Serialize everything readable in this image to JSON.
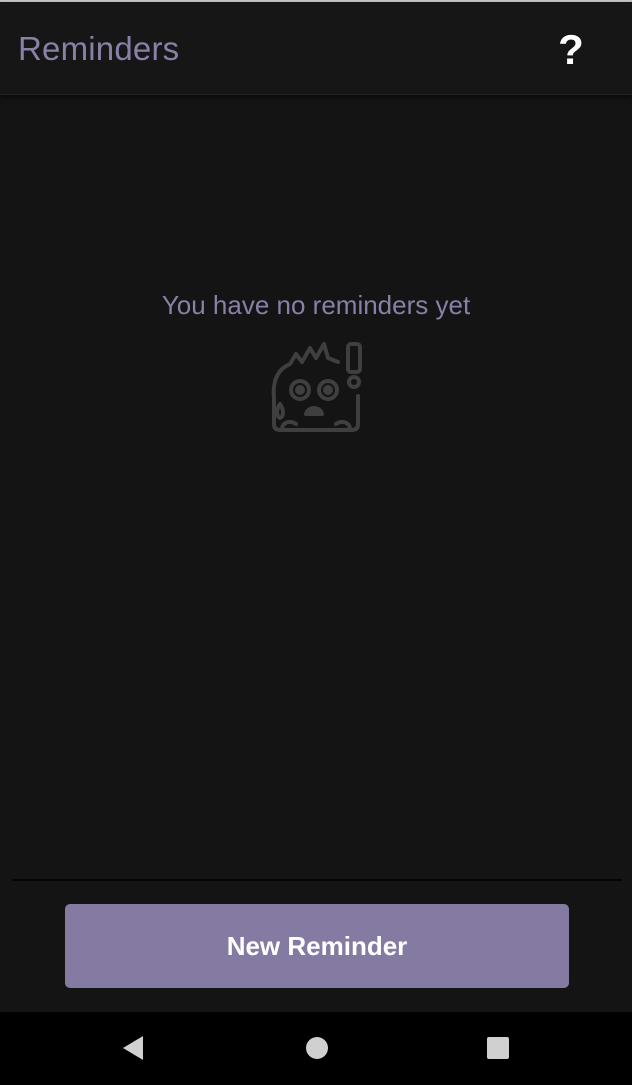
{
  "header": {
    "title": "Reminders",
    "help_label": "?"
  },
  "empty_state": {
    "message": "You have no reminders yet",
    "icon": "surprised-creature-icon"
  },
  "actions": {
    "new_reminder_label": "New Reminder"
  },
  "nav": {
    "back_icon": "back-triangle-icon",
    "home_icon": "home-circle-icon",
    "recents_icon": "recents-square-icon"
  },
  "colors": {
    "accent": "#857ba2",
    "title_text": "#8a7fa6",
    "background": "#141414"
  }
}
